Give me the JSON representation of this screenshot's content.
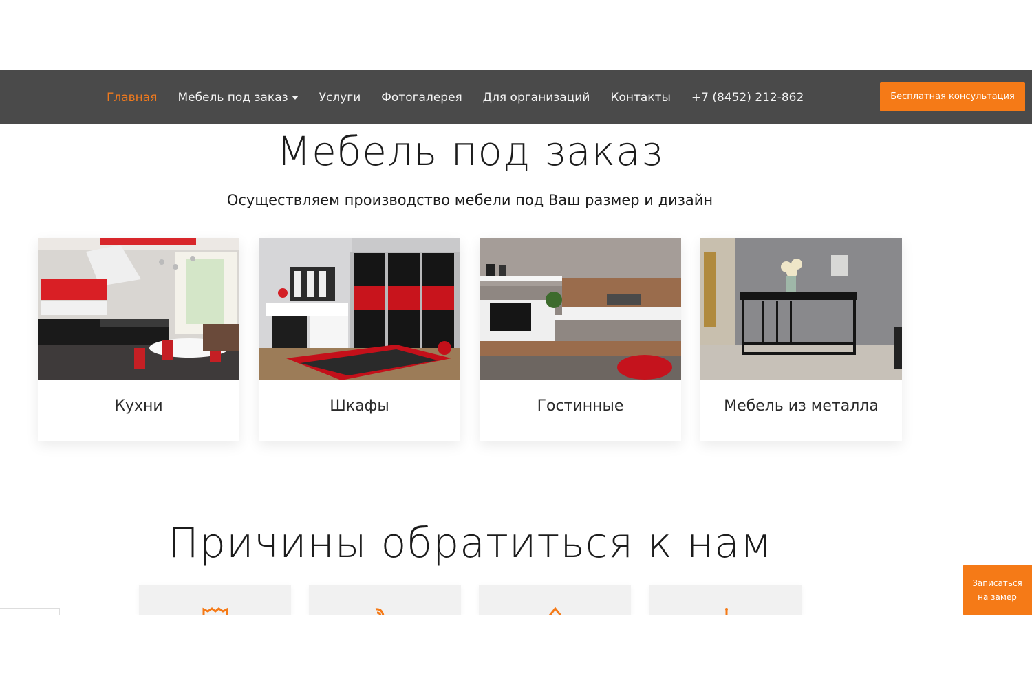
{
  "nav": {
    "items": [
      {
        "label": "Главная"
      },
      {
        "label": "Мебель под заказ"
      },
      {
        "label": "Услуги"
      },
      {
        "label": "Фотогалерея"
      },
      {
        "label": "Для организаций"
      },
      {
        "label": "Контакты"
      },
      {
        "label": "+7 (8452) 212-862"
      }
    ],
    "active_color": "#f07a1e",
    "cta_label": "Бесплатная консультация"
  },
  "hero": {
    "title": "Мебель под заказ",
    "subtitle": "Осуществляем производство мебели под Ваш размер и дизайн"
  },
  "categories": [
    {
      "label": "Кухни",
      "image": "kitchen-photo"
    },
    {
      "label": "Шкафы",
      "image": "wardrobe-photo"
    },
    {
      "label": "Гостинные",
      "image": "living-room-photo"
    },
    {
      "label": "Мебель из металла",
      "image": "metal-furniture-photo"
    }
  ],
  "reasons": {
    "title": "Причины обратиться к нам",
    "icons": [
      "reason-1-icon",
      "reason-2-icon",
      "reason-3-icon",
      "reason-4-icon"
    ]
  },
  "floating_button": {
    "line1": "Записаться",
    "line2": "на замер"
  },
  "colors": {
    "accent": "#f57a17",
    "nav_bg": "#4a4a4a"
  }
}
